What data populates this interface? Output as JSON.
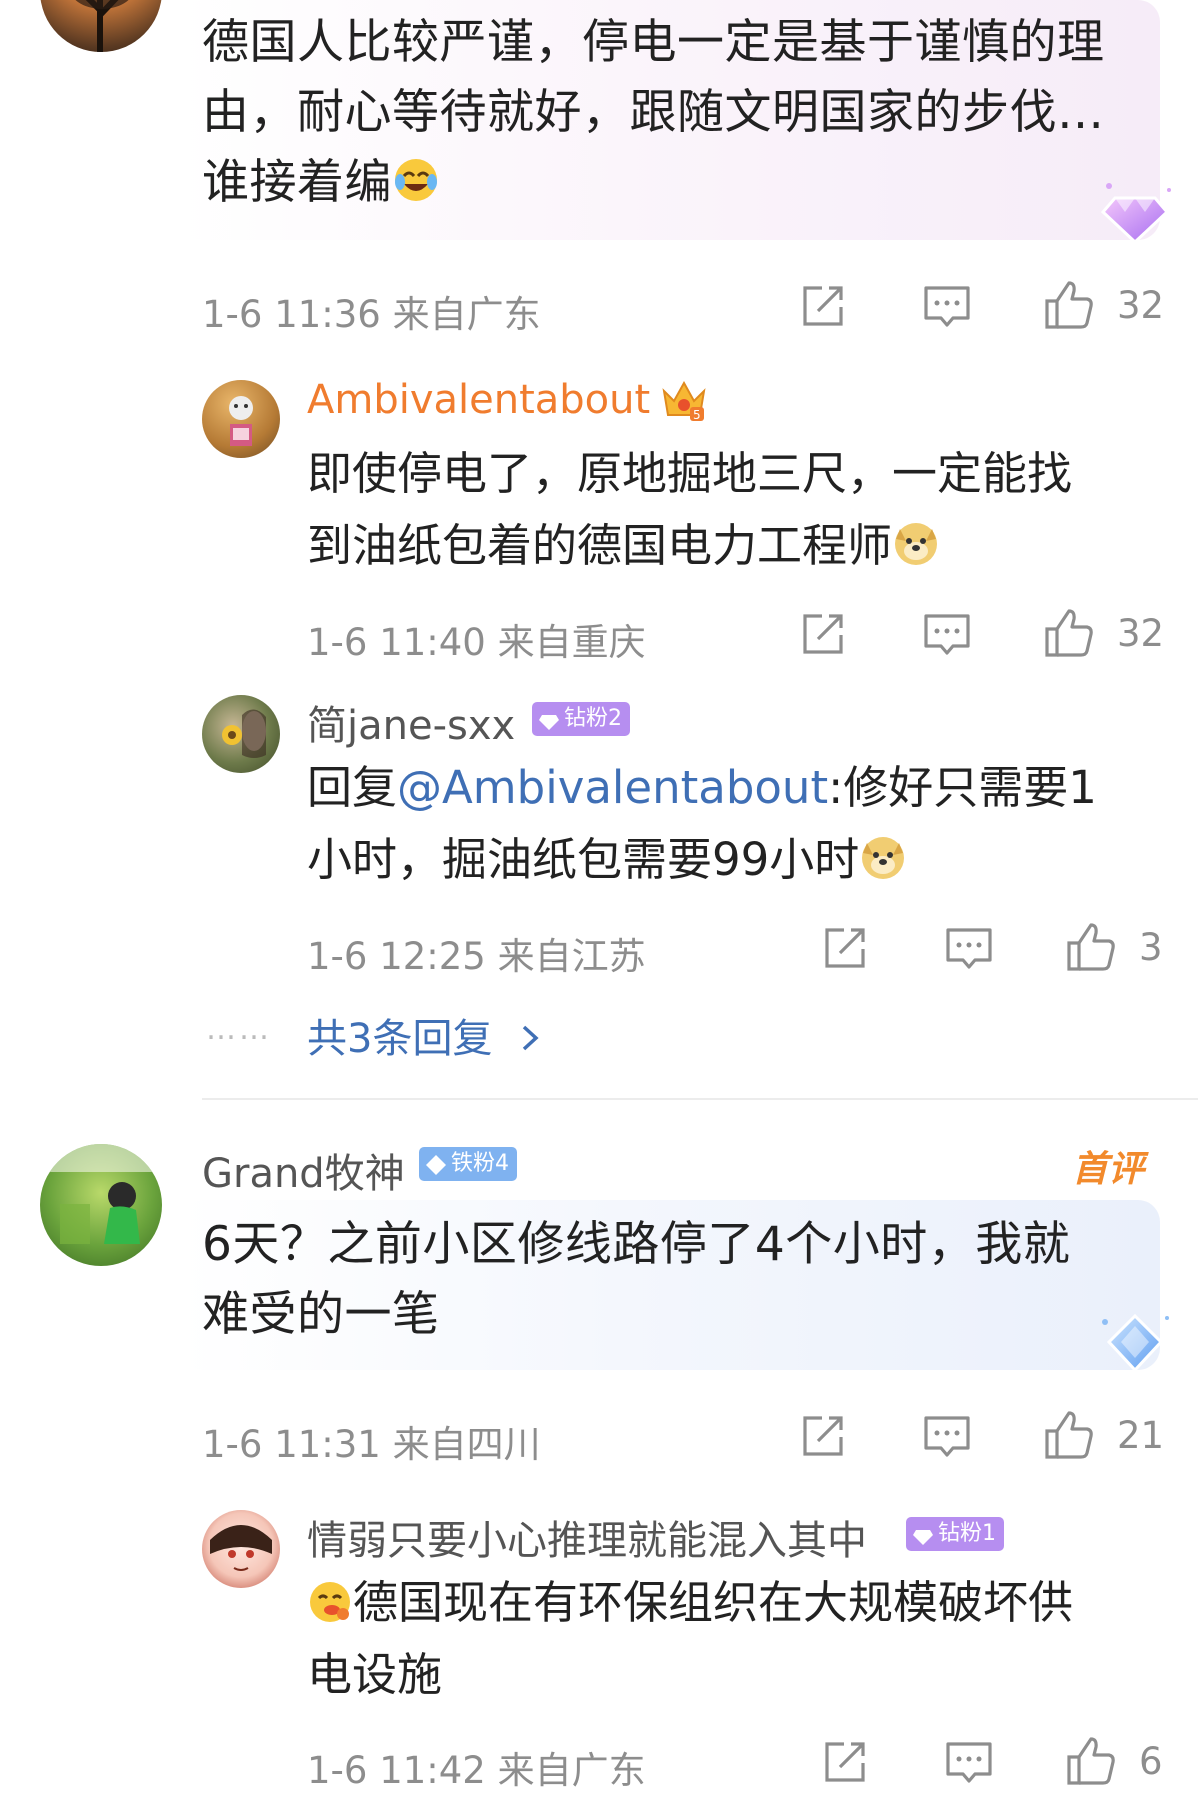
{
  "comments": [
    {
      "text": "德国人比较严谨，停电一定是基于谨慎的理由，耐心等待就好，跟随文明国家的步伐…谁接着编",
      "line1": "德国人比较严谨，停电一定是基于谨慎的理",
      "line2": "由，耐心等待就好，跟随文明国家的步伐…",
      "line3": "谁接着编",
      "time": "1-6 11:36 来自广东",
      "likes": "32",
      "replies": [
        {
          "user": "Ambivalentabout",
          "line1": "即使停电了，原地掘地三尺，一定能找",
          "line2": "到油纸包着的德国电力工程师",
          "time": "1-6 11:40 来自重庆",
          "likes": "32"
        },
        {
          "user": "简jane-sxx",
          "badge": "钻粉2",
          "prefix": "回复",
          "mention": "@Ambivalentabout",
          "line1_rest": ":修好只需要1",
          "line2": "小时，掘油纸包需要99小时",
          "time": "1-6 12:25 来自江苏",
          "likes": "3"
        }
      ],
      "more_replies": "共3条回复",
      "dots": "……"
    },
    {
      "user": "Grand牧神",
      "badge": "铁粉4",
      "tag": "首评",
      "line1": "6天？之前小区修线路停了4个小时，我就",
      "line2": "难受的一笔",
      "time": "1-6 11:31 来自四川",
      "likes": "21",
      "replies": [
        {
          "user": "情弱只要小心推理就能混入其中",
          "badge": "钻粉1",
          "line1": "德国现在有环保组织在大规模破坏供",
          "line2": "电设施",
          "time": "1-6 11:42 来自广东",
          "likes": "6"
        }
      ]
    }
  ],
  "icons": [
    "share-icon",
    "comment-icon",
    "like-icon"
  ],
  "colors": {
    "link": "#3f6fb5",
    "vip_name": "#f07c2e",
    "meta": "#8d8d8d",
    "first_tag": "#f28a2c"
  }
}
